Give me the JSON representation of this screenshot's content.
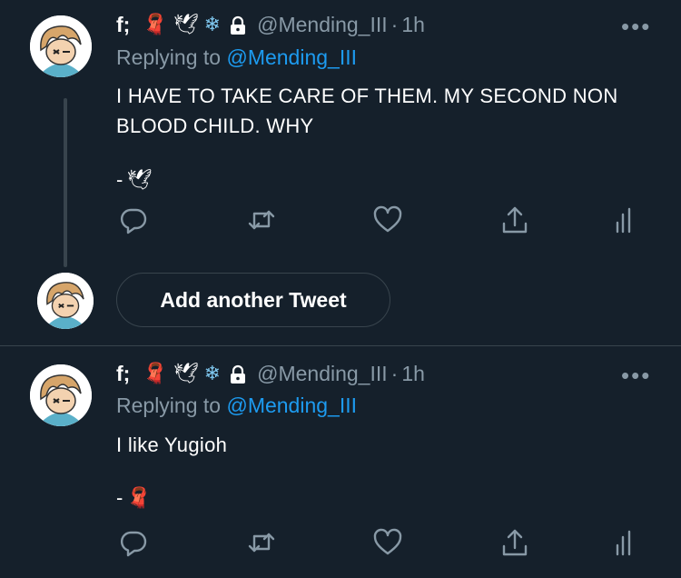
{
  "tweets": [
    {
      "display_name": "f;",
      "name_emojis": [
        "🧣",
        "🕊",
        "❄"
      ],
      "handle": "@Mending_III",
      "separator": "·",
      "time": "1h",
      "more": "•••",
      "replying_label": "Replying to",
      "replying_handle": "@Mending_III",
      "text_line1": "I HAVE TO TAKE CARE OF THEM. MY SECOND NON",
      "text_line2": "BLOOD CHILD. WHY",
      "signature_dash": "-",
      "signature_emoji": "🕊"
    },
    {
      "display_name": "f;",
      "name_emojis": [
        "🧣",
        "🕊",
        "❄"
      ],
      "handle": "@Mending_III",
      "separator": "·",
      "time": "1h",
      "more": "•••",
      "replying_label": "Replying to",
      "replying_handle": "@Mending_III",
      "text_line1": "I like Yugioh",
      "signature_dash": "-",
      "signature_emoji": "🧣"
    }
  ],
  "composer": {
    "add_button_label": "Add another Tweet"
  },
  "icons": [
    "reply-icon",
    "retweet-icon",
    "like-icon",
    "share-icon",
    "analytics-icon",
    "lock-icon",
    "more-icon"
  ],
  "colors": {
    "background": "#15202b",
    "secondary_text": "#8899a6",
    "accent": "#1d9bf0",
    "border": "#38444d"
  }
}
